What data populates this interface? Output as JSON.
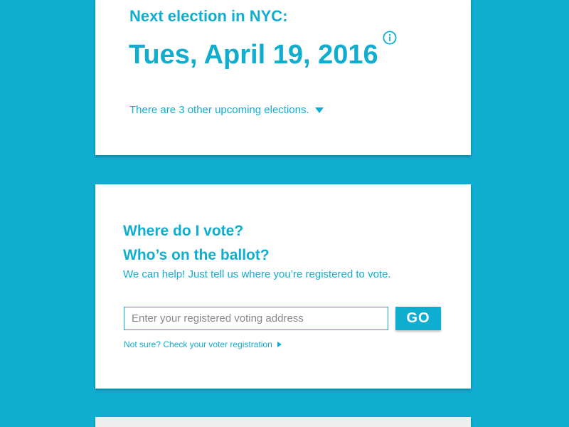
{
  "colors": {
    "background": "#0faed0",
    "accent": "#0faed0",
    "card": "#ffffff",
    "text_muted": "#888888"
  },
  "election": {
    "label": "Next election in NYC:",
    "date": "Tues, April 19, 2016",
    "info_icon": "info-icon",
    "upcoming_text": "There are 3 other upcoming elections.",
    "upcoming_icon": "caret-down-icon"
  },
  "vote": {
    "question1": "Where do I vote?",
    "question2": "Who’s on the ballot?",
    "help_text": "We can help! Just tell us where you’re registered to vote.",
    "address_value": "",
    "address_placeholder": "Enter your registered voting address",
    "go_label": "GO",
    "not_sure_text": "Not sure? Check your voter registration",
    "not_sure_icon": "caret-right-icon"
  }
}
